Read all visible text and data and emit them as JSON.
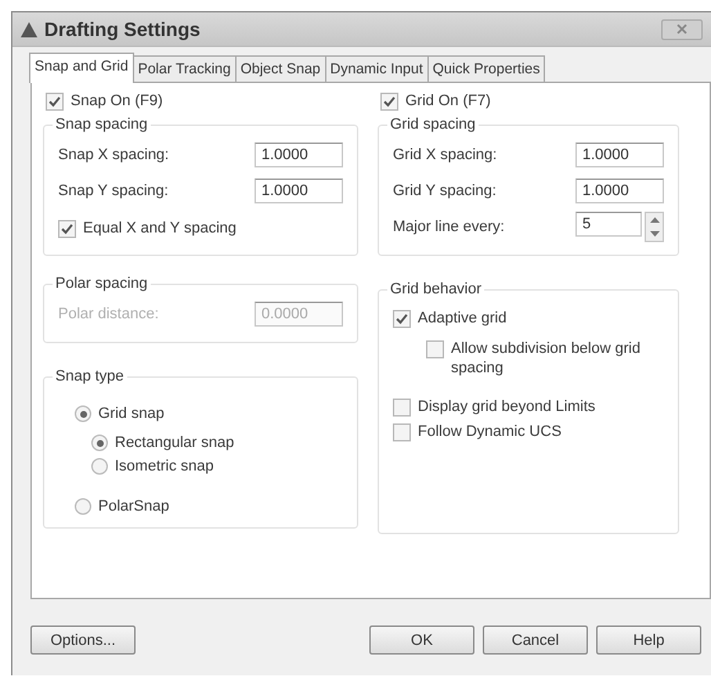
{
  "window": {
    "title": "Drafting Settings"
  },
  "tabs": [
    {
      "label": "Snap and Grid",
      "selected": true
    },
    {
      "label": "Polar Tracking",
      "selected": false
    },
    {
      "label": "Object Snap",
      "selected": false
    },
    {
      "label": "Dynamic Input",
      "selected": false
    },
    {
      "label": "Quick Properties",
      "selected": false
    }
  ],
  "snap_on": {
    "label": "Snap On (F9)",
    "checked": true
  },
  "snap_spacing": {
    "title": "Snap spacing",
    "fields": [
      {
        "label": "Snap X spacing:",
        "value": "1.0000"
      },
      {
        "label": "Snap Y spacing:",
        "value": "1.0000"
      }
    ],
    "equal": {
      "label": "Equal X and Y spacing",
      "checked": true
    }
  },
  "polar_spacing": {
    "title": "Polar spacing",
    "field": {
      "label": "Polar distance:",
      "value": "0.0000",
      "disabled": true
    }
  },
  "snap_type": {
    "title": "Snap type",
    "options": [
      {
        "label": "Grid snap",
        "selected": true,
        "children": [
          {
            "label": "Rectangular snap",
            "selected": true
          },
          {
            "label": "Isometric snap",
            "selected": false
          }
        ]
      },
      {
        "label": "PolarSnap",
        "selected": false
      }
    ]
  },
  "grid_on": {
    "label": "Grid On (F7)",
    "checked": true
  },
  "grid_spacing": {
    "title": "Grid spacing",
    "fields": [
      {
        "label": "Grid X spacing:",
        "value": "1.0000",
        "kind": "text"
      },
      {
        "label": "Grid Y spacing:",
        "value": "1.0000",
        "kind": "text"
      },
      {
        "label": "Major line every:",
        "value": "5",
        "kind": "spinner"
      }
    ]
  },
  "grid_behavior": {
    "title": "Grid behavior",
    "options": [
      {
        "label": "Adaptive grid",
        "checked": true,
        "children": [
          {
            "label": "Allow subdivision below grid spacing",
            "checked": false
          }
        ]
      },
      {
        "label": "Display grid beyond Limits",
        "checked": false
      },
      {
        "label": "Follow Dynamic UCS",
        "checked": false
      }
    ]
  },
  "buttons_left": [
    "Options..."
  ],
  "buttons_right": [
    "OK",
    "Cancel",
    "Help"
  ]
}
